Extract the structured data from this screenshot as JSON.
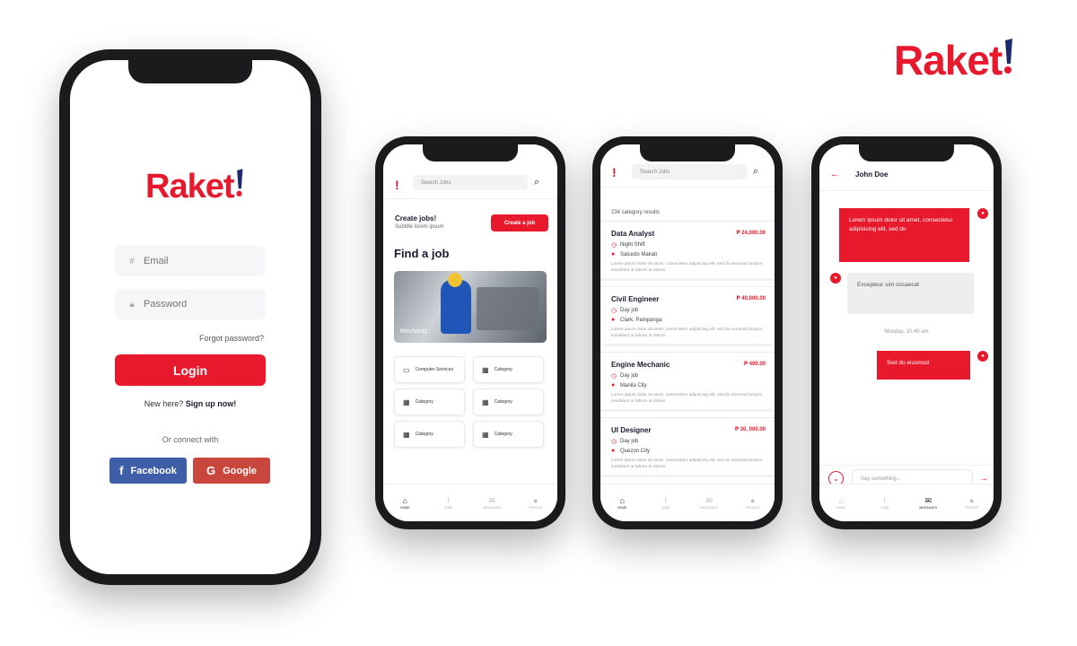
{
  "brand": {
    "name": "Raket",
    "accent": "#e8192c",
    "dark": "#1a1a2e"
  },
  "login": {
    "logo": "Raket",
    "email_placeholder": "Email",
    "password_placeholder": "Password",
    "forgot": "Forgot password?",
    "login_label": "Login",
    "new_here": "New here?",
    "signup": "Sign up now!",
    "or_connect": "Or connect with",
    "facebook": "Facebook",
    "google": "Google"
  },
  "home": {
    "search_placeholder": "Search Jobs",
    "create_title": "Create jobs!",
    "create_sub": "Subtitle lorem ipsum",
    "create_btn": "Create a job",
    "find_title": "Find a job",
    "hero_label": "Mechanic",
    "categories": [
      "Computer Services",
      "Category",
      "Category",
      "Category",
      "Category",
      "Category"
    ]
  },
  "jobs": {
    "search_placeholder": "Search Jobs",
    "results": "234 category results",
    "list": [
      {
        "title": "Data Analyst",
        "price": "₱ 24,000.00",
        "type": "Night Shift",
        "location": "Salcedo Makati",
        "desc": "Lorem ipsum dolor sit amet, consectetur adipiscing elit, sed do eiusmod tempor incididunt ut labore et dolore"
      },
      {
        "title": "Civil Engineer",
        "price": "₱ 40,000.00",
        "type": "Day job",
        "location": "Clark, Pampanga",
        "desc": "Lorem ipsum dolor sit amet, consectetur adipiscing elit, sed do eiusmod tempor incididunt ut labore et dolore"
      },
      {
        "title": "Engine Mechanic",
        "price": "₱ 400.00",
        "type": "Day job",
        "location": "Manila City",
        "desc": "Lorem ipsum dolor sit amet, consectetur adipiscing elit, sed do eiusmod tempor incididunt ut labore et dolore"
      },
      {
        "title": "UI Designer",
        "price": "₱ 30, 000.00",
        "type": "Day job",
        "location": "Quezon City",
        "desc": "Lorem ipsum dolor sit amet, consectetur adipiscing elit, sed do eiusmod tempor incididunt ut labore et dolore"
      }
    ]
  },
  "chat": {
    "name": "John Doe",
    "msg1": "Lorem ipsum dolor sit amet, consectetur adipisicing elit, sed do",
    "msg2": "Excepteur sint occaecat",
    "time": "Monday, 10:40 am",
    "msg3": "Sed do eiusmod",
    "input_placeholder": "Say something..."
  },
  "tabs": [
    "HOME",
    "JOBS",
    "MESSAGES",
    "PROFILE"
  ],
  "icons": {
    "home": "home-icon",
    "jobs": "raket-icon",
    "messages": "mail-icon",
    "profile": "person-icon",
    "search": "search-icon",
    "pin": "location-pin-icon",
    "clock": "clock-icon"
  }
}
